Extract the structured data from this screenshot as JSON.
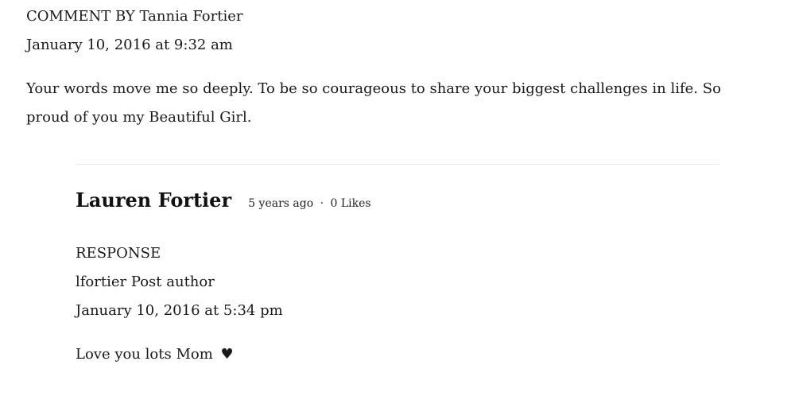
{
  "comment": {
    "heading_prefix": "COMMENT BY",
    "author": "Tannia Fortier",
    "date": "January 10, 2016 at 9:32 am",
    "body": "Your words move me so deeply. To be so courageous to share your biggest challenges in life. So proud of you my Beautiful Girl."
  },
  "reply": {
    "author_name": "Lauren Fortier",
    "time_ago": "5 years ago",
    "separator": "·",
    "likes": "0 Likes",
    "label": "RESPONSE",
    "byline": "lfortier Post author",
    "date": "January 10, 2016 at 5:34 pm",
    "body": "Love you lots Mom",
    "body_icon": "heart-icon",
    "heart_glyph": "♥"
  }
}
